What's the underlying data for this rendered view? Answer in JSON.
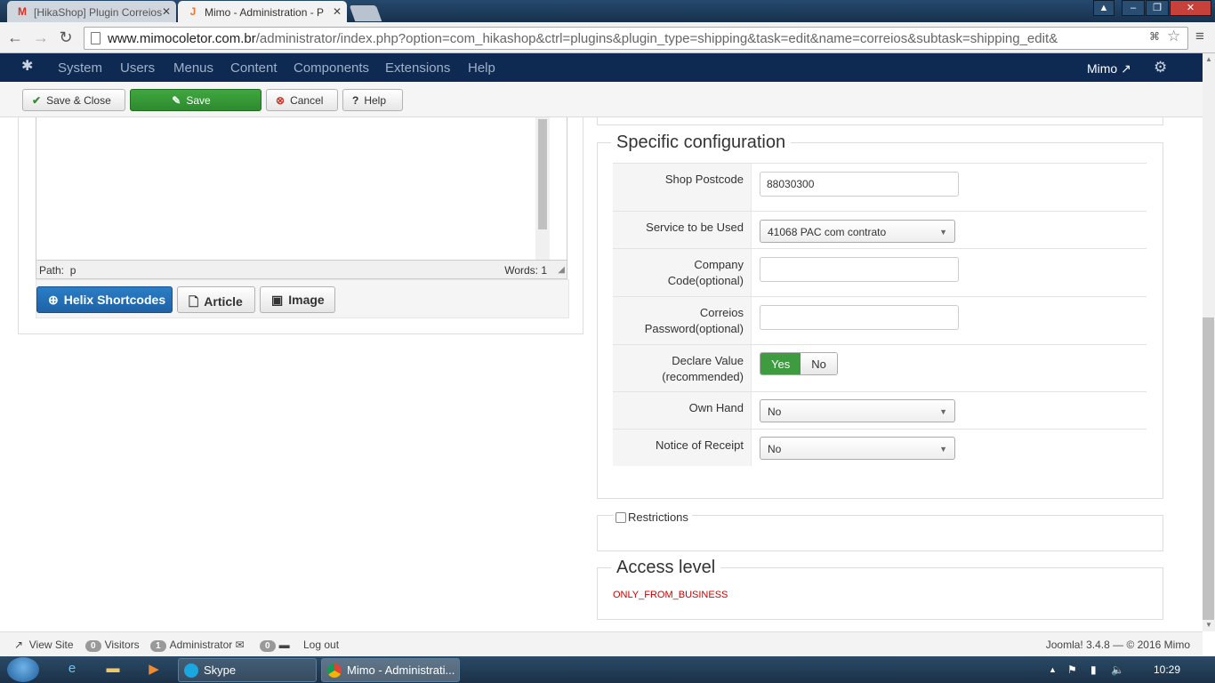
{
  "browser": {
    "tabs": [
      {
        "label": "[HikaShop] Plugin Correios",
        "favicon": "M"
      },
      {
        "label": "Mimo - Administration - P",
        "favicon": "J"
      }
    ],
    "url_host": "www.mimocoletor.com.br",
    "url_path": "/administrator/index.php?option=com_hikashop&ctrl=plugins&plugin_type=shipping&task=edit&name=correios&subtask=shipping_edit&"
  },
  "joomla": {
    "menu": [
      "System",
      "Users",
      "Menus",
      "Content",
      "Components",
      "Extensions",
      "Help"
    ],
    "site_name": "Mimo",
    "toolbar": {
      "save_close": "Save & Close",
      "save": "Save",
      "cancel": "Cancel",
      "help": "Help"
    }
  },
  "editor": {
    "path_label": "Path:",
    "path_value": "p",
    "words_label": "Words: 1",
    "buttons": [
      "Helix Shortcodes",
      "Article",
      "Image"
    ]
  },
  "specific": {
    "legend": "Specific configuration",
    "shop_postcode_label": "Shop Postcode",
    "shop_postcode_value": "88030300",
    "service_label": "Service to be Used",
    "service_value": "41068 PAC com contrato",
    "company_code_label_1": "Company",
    "company_code_label_2": "Code(optional)",
    "correios_password_label_1": "Correios",
    "correios_password_label_2": "Password(optional)",
    "declare_value_label_1": "Declare Value",
    "declare_value_label_2": "(recommended)",
    "declare_yes": "Yes",
    "declare_no": "No",
    "own_hand_label": "Own Hand",
    "own_hand_value": "No",
    "notice_label": "Notice of Receipt",
    "notice_value": "No"
  },
  "restrictions": {
    "label": "Restrictions"
  },
  "access": {
    "legend": "Access level",
    "value": "ONLY_FROM_BUSINESS",
    "value_color": "#cc0000"
  },
  "footer": {
    "view_site": "View Site",
    "visitors_count": "0",
    "visitors_label": "Visitors",
    "admin_count": "1",
    "admin_label": "Administrator",
    "messages_count": "0",
    "logout": "Log out",
    "version": "Joomla! 3.4.8 — © 2016 Mimo"
  },
  "taskbar": {
    "apps": [
      "Skype",
      "Mimo - Administrati..."
    ],
    "clock": "10:29"
  }
}
